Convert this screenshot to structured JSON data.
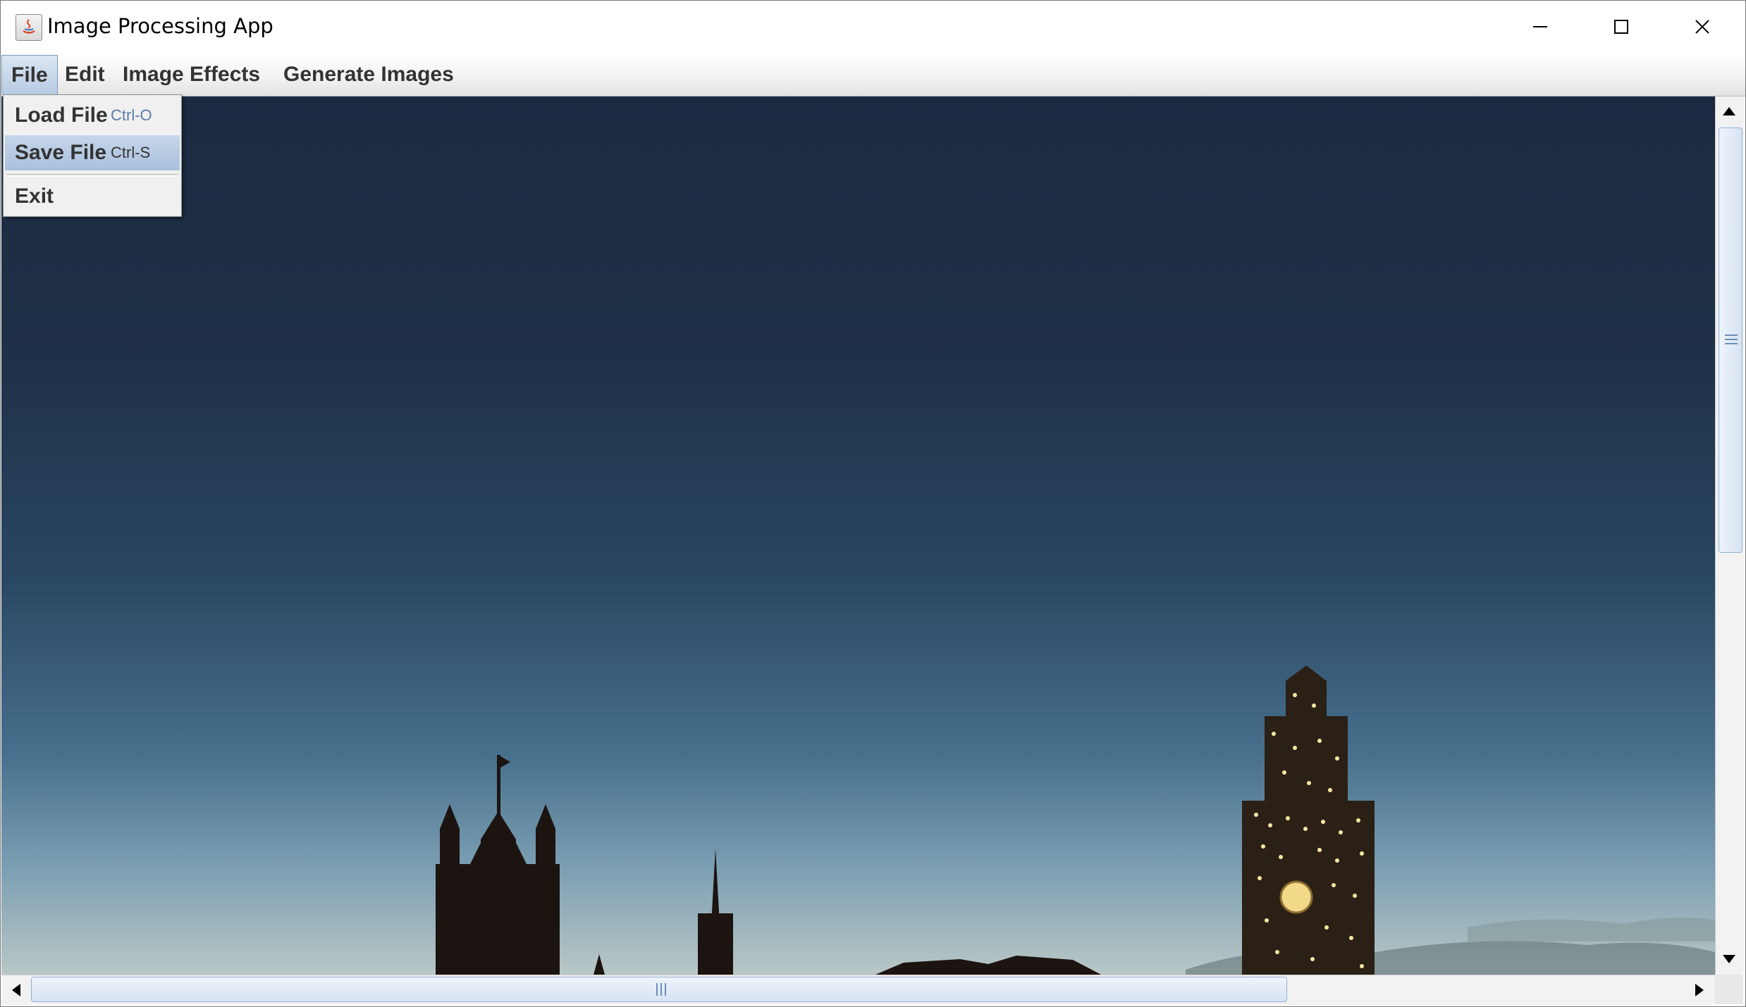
{
  "window": {
    "title": "Image Processing App",
    "controls": {
      "minimize": "minimize-icon",
      "maximize": "maximize-icon",
      "close": "close-icon"
    }
  },
  "menubar": {
    "items": [
      {
        "label": "File",
        "active": true
      },
      {
        "label": "Edit"
      },
      {
        "label": "Image Effects"
      },
      {
        "label": "Generate Images"
      }
    ]
  },
  "file_menu": {
    "items": [
      {
        "label": "Load File",
        "shortcut": "Ctrl-O"
      },
      {
        "label": "Save File",
        "shortcut": "Ctrl-S",
        "highlighted": true
      },
      {
        "label": "Exit"
      }
    ]
  },
  "scrollbars": {
    "vertical": {
      "thumb_fraction": 0.48,
      "position_fraction": 0.0
    },
    "horizontal": {
      "thumb_fraction": 0.75,
      "position_fraction": 0.0
    }
  },
  "colors": {
    "menu_highlight": "#b8cbe3",
    "scroll_thumb": "#d6e3f2",
    "sky_top": "#1b2a41",
    "sky_bottom": "#b9c7c6"
  }
}
